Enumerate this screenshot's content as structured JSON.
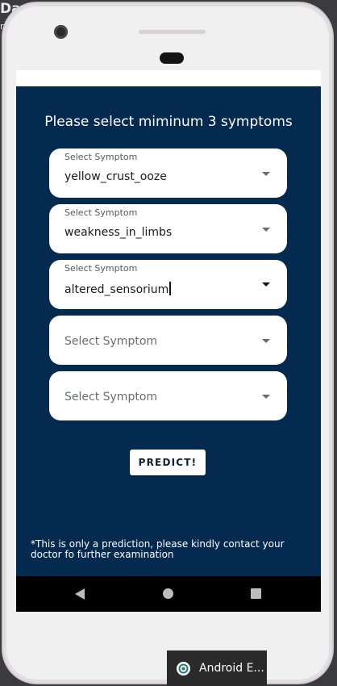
{
  "desktop": {
    "partial_title": "Davi",
    "partial_subtitle": "r"
  },
  "app": {
    "title": "Please select miminum 3 symptoms",
    "fields": [
      {
        "label": "Select Symptom",
        "value": "yellow_crust_ooze"
      },
      {
        "label": "Select Symptom",
        "value": "weakness_in_limbs"
      },
      {
        "label": "Select Symptom",
        "value": "altered_sensorium"
      },
      {
        "placeholder": "Select Symptom"
      },
      {
        "placeholder": "Select Symptom"
      }
    ],
    "predict_label": "PREDICT!",
    "disclaimer": "*This is only a prediction, please kindly contact your doctor fo further examination",
    "colors": {
      "background": "#042a50",
      "field": "#ffffff",
      "text": "#ffffff"
    }
  },
  "navbar": {
    "icons": [
      "back-icon",
      "home-icon",
      "recents-icon"
    ]
  },
  "taskbar": {
    "label": "Android E...",
    "icon": "android-emulator-icon"
  }
}
